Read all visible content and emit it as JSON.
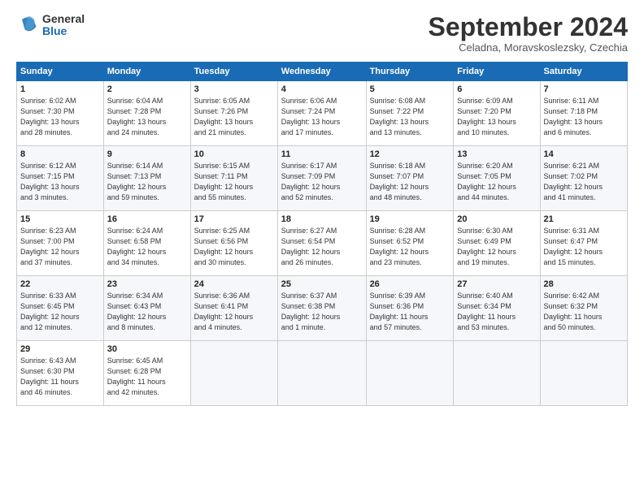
{
  "header": {
    "logo_general": "General",
    "logo_blue": "Blue",
    "title": "September 2024",
    "location": "Celadna, Moravskoslezsky, Czechia"
  },
  "days_of_week": [
    "Sunday",
    "Monday",
    "Tuesday",
    "Wednesday",
    "Thursday",
    "Friday",
    "Saturday"
  ],
  "weeks": [
    [
      {
        "day": "1",
        "lines": [
          "Sunrise: 6:02 AM",
          "Sunset: 7:30 PM",
          "Daylight: 13 hours",
          "and 28 minutes."
        ]
      },
      {
        "day": "2",
        "lines": [
          "Sunrise: 6:04 AM",
          "Sunset: 7:28 PM",
          "Daylight: 13 hours",
          "and 24 minutes."
        ]
      },
      {
        "day": "3",
        "lines": [
          "Sunrise: 6:05 AM",
          "Sunset: 7:26 PM",
          "Daylight: 13 hours",
          "and 21 minutes."
        ]
      },
      {
        "day": "4",
        "lines": [
          "Sunrise: 6:06 AM",
          "Sunset: 7:24 PM",
          "Daylight: 13 hours",
          "and 17 minutes."
        ]
      },
      {
        "day": "5",
        "lines": [
          "Sunrise: 6:08 AM",
          "Sunset: 7:22 PM",
          "Daylight: 13 hours",
          "and 13 minutes."
        ]
      },
      {
        "day": "6",
        "lines": [
          "Sunrise: 6:09 AM",
          "Sunset: 7:20 PM",
          "Daylight: 13 hours",
          "and 10 minutes."
        ]
      },
      {
        "day": "7",
        "lines": [
          "Sunrise: 6:11 AM",
          "Sunset: 7:18 PM",
          "Daylight: 13 hours",
          "and 6 minutes."
        ]
      }
    ],
    [
      {
        "day": "8",
        "lines": [
          "Sunrise: 6:12 AM",
          "Sunset: 7:15 PM",
          "Daylight: 13 hours",
          "and 3 minutes."
        ]
      },
      {
        "day": "9",
        "lines": [
          "Sunrise: 6:14 AM",
          "Sunset: 7:13 PM",
          "Daylight: 12 hours",
          "and 59 minutes."
        ]
      },
      {
        "day": "10",
        "lines": [
          "Sunrise: 6:15 AM",
          "Sunset: 7:11 PM",
          "Daylight: 12 hours",
          "and 55 minutes."
        ]
      },
      {
        "day": "11",
        "lines": [
          "Sunrise: 6:17 AM",
          "Sunset: 7:09 PM",
          "Daylight: 12 hours",
          "and 52 minutes."
        ]
      },
      {
        "day": "12",
        "lines": [
          "Sunrise: 6:18 AM",
          "Sunset: 7:07 PM",
          "Daylight: 12 hours",
          "and 48 minutes."
        ]
      },
      {
        "day": "13",
        "lines": [
          "Sunrise: 6:20 AM",
          "Sunset: 7:05 PM",
          "Daylight: 12 hours",
          "and 44 minutes."
        ]
      },
      {
        "day": "14",
        "lines": [
          "Sunrise: 6:21 AM",
          "Sunset: 7:02 PM",
          "Daylight: 12 hours",
          "and 41 minutes."
        ]
      }
    ],
    [
      {
        "day": "15",
        "lines": [
          "Sunrise: 6:23 AM",
          "Sunset: 7:00 PM",
          "Daylight: 12 hours",
          "and 37 minutes."
        ]
      },
      {
        "day": "16",
        "lines": [
          "Sunrise: 6:24 AM",
          "Sunset: 6:58 PM",
          "Daylight: 12 hours",
          "and 34 minutes."
        ]
      },
      {
        "day": "17",
        "lines": [
          "Sunrise: 6:25 AM",
          "Sunset: 6:56 PM",
          "Daylight: 12 hours",
          "and 30 minutes."
        ]
      },
      {
        "day": "18",
        "lines": [
          "Sunrise: 6:27 AM",
          "Sunset: 6:54 PM",
          "Daylight: 12 hours",
          "and 26 minutes."
        ]
      },
      {
        "day": "19",
        "lines": [
          "Sunrise: 6:28 AM",
          "Sunset: 6:52 PM",
          "Daylight: 12 hours",
          "and 23 minutes."
        ]
      },
      {
        "day": "20",
        "lines": [
          "Sunrise: 6:30 AM",
          "Sunset: 6:49 PM",
          "Daylight: 12 hours",
          "and 19 minutes."
        ]
      },
      {
        "day": "21",
        "lines": [
          "Sunrise: 6:31 AM",
          "Sunset: 6:47 PM",
          "Daylight: 12 hours",
          "and 15 minutes."
        ]
      }
    ],
    [
      {
        "day": "22",
        "lines": [
          "Sunrise: 6:33 AM",
          "Sunset: 6:45 PM",
          "Daylight: 12 hours",
          "and 12 minutes."
        ]
      },
      {
        "day": "23",
        "lines": [
          "Sunrise: 6:34 AM",
          "Sunset: 6:43 PM",
          "Daylight: 12 hours",
          "and 8 minutes."
        ]
      },
      {
        "day": "24",
        "lines": [
          "Sunrise: 6:36 AM",
          "Sunset: 6:41 PM",
          "Daylight: 12 hours",
          "and 4 minutes."
        ]
      },
      {
        "day": "25",
        "lines": [
          "Sunrise: 6:37 AM",
          "Sunset: 6:38 PM",
          "Daylight: 12 hours",
          "and 1 minute."
        ]
      },
      {
        "day": "26",
        "lines": [
          "Sunrise: 6:39 AM",
          "Sunset: 6:36 PM",
          "Daylight: 11 hours",
          "and 57 minutes."
        ]
      },
      {
        "day": "27",
        "lines": [
          "Sunrise: 6:40 AM",
          "Sunset: 6:34 PM",
          "Daylight: 11 hours",
          "and 53 minutes."
        ]
      },
      {
        "day": "28",
        "lines": [
          "Sunrise: 6:42 AM",
          "Sunset: 6:32 PM",
          "Daylight: 11 hours",
          "and 50 minutes."
        ]
      }
    ],
    [
      {
        "day": "29",
        "lines": [
          "Sunrise: 6:43 AM",
          "Sunset: 6:30 PM",
          "Daylight: 11 hours",
          "and 46 minutes."
        ]
      },
      {
        "day": "30",
        "lines": [
          "Sunrise: 6:45 AM",
          "Sunset: 6:28 PM",
          "Daylight: 11 hours",
          "and 42 minutes."
        ]
      },
      null,
      null,
      null,
      null,
      null
    ]
  ]
}
